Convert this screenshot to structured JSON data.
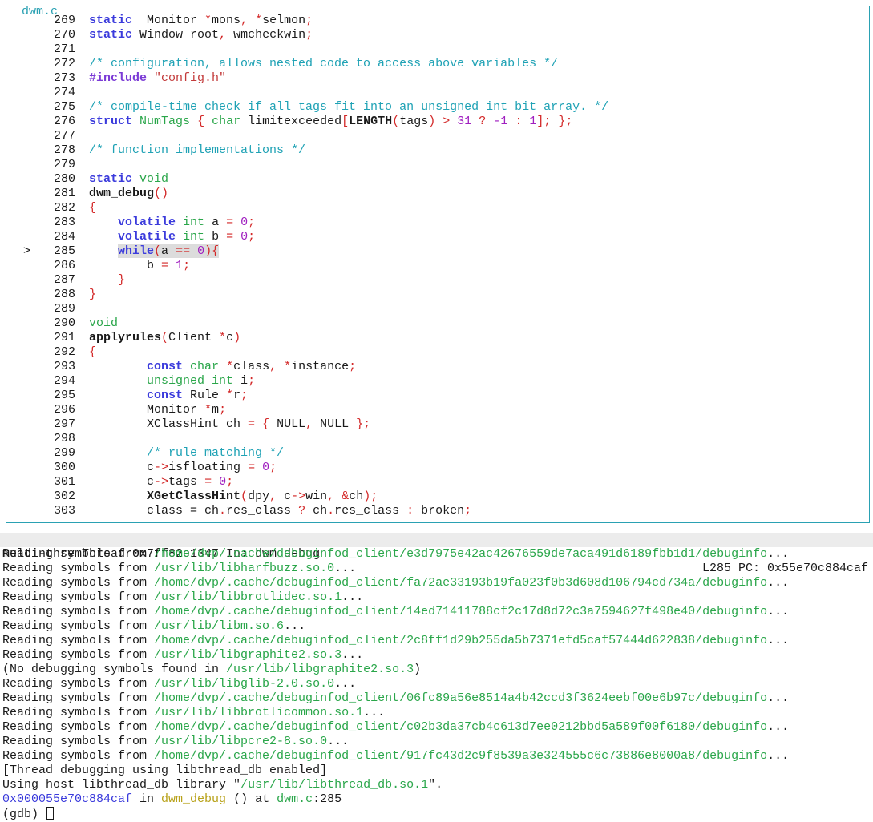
{
  "window": {
    "title": "dwm.c"
  },
  "source": {
    "current_line": 285,
    "marker": ">",
    "lines": [
      {
        "n": "269",
        "tokens": [
          [
            "kw",
            "static"
          ],
          [
            "",
            "  Monitor "
          ],
          [
            "op",
            "*"
          ],
          [
            "",
            "mons"
          ],
          [
            "op",
            ","
          ],
          [
            "",
            " "
          ],
          [
            "op",
            "*"
          ],
          [
            "",
            "selmon"
          ],
          [
            "op",
            ";"
          ]
        ]
      },
      {
        "n": "270",
        "tokens": [
          [
            "kw",
            "static"
          ],
          [
            "",
            " Window root"
          ],
          [
            "op",
            ","
          ],
          [
            "",
            " wmcheckwin"
          ],
          [
            "op",
            ";"
          ]
        ]
      },
      {
        "n": "271",
        "tokens": []
      },
      {
        "n": "272",
        "tokens": [
          [
            "cm",
            "/* configuration, allows nested code to access above variables */"
          ]
        ]
      },
      {
        "n": "273",
        "tokens": [
          [
            "pp",
            "#include"
          ],
          [
            "",
            " "
          ],
          [
            "st",
            "\"config.h\""
          ]
        ]
      },
      {
        "n": "274",
        "tokens": []
      },
      {
        "n": "275",
        "tokens": [
          [
            "cm",
            "/* compile-time check if all tags fit into an unsigned int bit array. */"
          ]
        ]
      },
      {
        "n": "276",
        "tokens": [
          [
            "kw",
            "struct"
          ],
          [
            "",
            " "
          ],
          [
            "ty",
            "NumTags"
          ],
          [
            "",
            " "
          ],
          [
            "op",
            "{"
          ],
          [
            "",
            " "
          ],
          [
            "ty",
            "char"
          ],
          [
            "",
            " limitexceeded"
          ],
          [
            "op",
            "["
          ],
          [
            "fn",
            "LENGTH"
          ],
          [
            "op",
            "("
          ],
          [
            "",
            "tags"
          ],
          [
            "op",
            ")"
          ],
          [
            "",
            " "
          ],
          [
            "op",
            ">"
          ],
          [
            "",
            " "
          ],
          [
            "nu",
            "31"
          ],
          [
            "",
            " "
          ],
          [
            "op",
            "?"
          ],
          [
            "",
            " "
          ],
          [
            "nu",
            "-1"
          ],
          [
            "",
            " "
          ],
          [
            "op",
            ":"
          ],
          [
            "",
            " "
          ],
          [
            "nu",
            "1"
          ],
          [
            "op",
            "];"
          ],
          [
            "",
            " "
          ],
          [
            "op",
            "};"
          ]
        ]
      },
      {
        "n": "277",
        "tokens": []
      },
      {
        "n": "278",
        "tokens": [
          [
            "cm",
            "/* function implementations */"
          ]
        ]
      },
      {
        "n": "279",
        "tokens": []
      },
      {
        "n": "280",
        "tokens": [
          [
            "kw",
            "static"
          ],
          [
            "",
            " "
          ],
          [
            "ty",
            "void"
          ]
        ]
      },
      {
        "n": "281",
        "tokens": [
          [
            "fn",
            "dwm_debug"
          ],
          [
            "op",
            "()"
          ]
        ]
      },
      {
        "n": "282",
        "tokens": [
          [
            "op",
            "{"
          ]
        ]
      },
      {
        "n": "283",
        "tokens": [
          [
            "",
            " "
          ],
          [
            "kw",
            "volatile"
          ],
          [
            "",
            " "
          ],
          [
            "ty",
            "int"
          ],
          [
            "",
            " a "
          ],
          [
            "op",
            "="
          ],
          [
            "",
            " "
          ],
          [
            "nu",
            "0"
          ],
          [
            "op",
            ";"
          ]
        ]
      },
      {
        "n": "284",
        "tokens": [
          [
            "",
            " "
          ],
          [
            "kw",
            "volatile"
          ],
          [
            "",
            " "
          ],
          [
            "ty",
            "int"
          ],
          [
            "",
            " b "
          ],
          [
            "op",
            "="
          ],
          [
            "",
            " "
          ],
          [
            "nu",
            "0"
          ],
          [
            "op",
            ";"
          ]
        ]
      },
      {
        "n": "285",
        "tokens": [
          [
            "",
            " "
          ],
          [
            "kw",
            "while"
          ],
          [
            "op",
            "("
          ],
          [
            "",
            "a "
          ],
          [
            "op",
            "=="
          ],
          [
            "",
            " "
          ],
          [
            "nu",
            "0"
          ],
          [
            "op",
            "){"
          ]
        ],
        "highlight": true
      },
      {
        "n": "286",
        "tokens": [
          [
            "",
            " b "
          ],
          [
            "op",
            "="
          ],
          [
            "",
            " "
          ],
          [
            "nu",
            "1"
          ],
          [
            "op",
            ";"
          ]
        ]
      },
      {
        "n": "287",
        "tokens": [
          [
            "",
            " "
          ],
          [
            "op",
            "}"
          ]
        ]
      },
      {
        "n": "288",
        "tokens": [
          [
            "op",
            "}"
          ]
        ]
      },
      {
        "n": "289",
        "tokens": []
      },
      {
        "n": "290",
        "tokens": [
          [
            "ty",
            "void"
          ]
        ]
      },
      {
        "n": "291",
        "tokens": [
          [
            "fn",
            "applyrules"
          ],
          [
            "op",
            "("
          ],
          [
            "",
            "Client "
          ],
          [
            "op",
            "*"
          ],
          [
            "",
            "c"
          ],
          [
            "op",
            ")"
          ]
        ]
      },
      {
        "n": "292",
        "tokens": [
          [
            "op",
            "{"
          ]
        ]
      },
      {
        "n": "293",
        "tokens": [
          [
            "",
            " "
          ],
          [
            "kw",
            "const"
          ],
          [
            "",
            " "
          ],
          [
            "ty",
            "char"
          ],
          [
            "",
            " "
          ],
          [
            "op",
            "*"
          ],
          [
            "",
            "class"
          ],
          [
            "op",
            ","
          ],
          [
            "",
            " "
          ],
          [
            "op",
            "*"
          ],
          [
            "",
            "instance"
          ],
          [
            "op",
            ";"
          ]
        ]
      },
      {
        "n": "294",
        "tokens": [
          [
            "",
            " "
          ],
          [
            "ty",
            "unsigned int"
          ],
          [
            "",
            " i"
          ],
          [
            "op",
            ";"
          ]
        ]
      },
      {
        "n": "295",
        "tokens": [
          [
            "",
            " "
          ],
          [
            "kw",
            "const"
          ],
          [
            "",
            " Rule "
          ],
          [
            "op",
            "*"
          ],
          [
            "",
            "r"
          ],
          [
            "op",
            ";"
          ]
        ]
      },
      {
        "n": "296",
        "tokens": [
          [
            "",
            " Monitor "
          ],
          [
            "op",
            "*"
          ],
          [
            "",
            "m"
          ],
          [
            "op",
            ";"
          ]
        ]
      },
      {
        "n": "297",
        "tokens": [
          [
            "",
            " XClassHint ch "
          ],
          [
            "op",
            "="
          ],
          [
            "",
            " "
          ],
          [
            "op",
            "{"
          ],
          [
            "",
            " NULL"
          ],
          [
            "op",
            ","
          ],
          [
            "",
            " NULL "
          ],
          [
            "op",
            "};"
          ]
        ]
      },
      {
        "n": "298",
        "tokens": []
      },
      {
        "n": "299",
        "tokens": [
          [
            "",
            " "
          ],
          [
            "cm",
            "/* rule matching */"
          ]
        ]
      },
      {
        "n": "300",
        "tokens": [
          [
            "",
            " c"
          ],
          [
            "op",
            "->"
          ],
          [
            "",
            "isfloating "
          ],
          [
            "op",
            "="
          ],
          [
            "",
            " "
          ],
          [
            "nu",
            "0"
          ],
          [
            "op",
            ";"
          ]
        ]
      },
      {
        "n": "301",
        "tokens": [
          [
            "",
            " c"
          ],
          [
            "op",
            "->"
          ],
          [
            "",
            "tags "
          ],
          [
            "op",
            "="
          ],
          [
            "",
            " "
          ],
          [
            "nu",
            "0"
          ],
          [
            "op",
            ";"
          ]
        ]
      },
      {
        "n": "302",
        "tokens": [
          [
            "",
            " "
          ],
          [
            "fn",
            "XGetClassHint"
          ],
          [
            "op",
            "("
          ],
          [
            "",
            "dpy"
          ],
          [
            "op",
            ","
          ],
          [
            "",
            " c"
          ],
          [
            "op",
            "->"
          ],
          [
            "",
            "win"
          ],
          [
            "op",
            ","
          ],
          [
            "",
            " "
          ],
          [
            "op",
            "&"
          ],
          [
            "",
            "ch"
          ],
          [
            "op",
            ");"
          ]
        ]
      },
      {
        "n": "303",
        "tokens": [
          [
            "",
            " class = ch"
          ],
          [
            "op",
            "."
          ],
          [
            "",
            "res_class "
          ],
          [
            "op",
            "?"
          ],
          [
            "",
            " ch"
          ],
          [
            "op",
            "."
          ],
          [
            "",
            "res_class "
          ],
          [
            "op",
            ":"
          ],
          [
            "",
            " broken"
          ],
          [
            "op",
            ";"
          ]
        ]
      }
    ]
  },
  "status_bar": {
    "left": "multi-thre Thread 0x7ff82c1347 In: dwm_debug",
    "right": "L285 PC: 0x55e70c884caf"
  },
  "command": {
    "lines": [
      {
        "parts": [
          [
            "",
            "Reading symbols from "
          ],
          [
            "path",
            "/home/dvp/.cache/debuginfod_client/e3d7975e42ac42676559de7aca491d6189fbb1d1/debuginfo"
          ],
          [
            "",
            "..."
          ]
        ]
      },
      {
        "parts": [
          [
            "",
            "Reading symbols from "
          ],
          [
            "path",
            "/usr/lib/libharfbuzz.so.0"
          ],
          [
            "",
            "..."
          ]
        ]
      },
      {
        "parts": [
          [
            "",
            "Reading symbols from "
          ],
          [
            "path",
            "/home/dvp/.cache/debuginfod_client/fa72ae33193b19fa023f0b3d608d106794cd734a/debuginfo"
          ],
          [
            "",
            "..."
          ]
        ]
      },
      {
        "parts": [
          [
            "",
            "Reading symbols from "
          ],
          [
            "path",
            "/usr/lib/libbrotlidec.so.1"
          ],
          [
            "",
            "..."
          ]
        ]
      },
      {
        "parts": [
          [
            "",
            "Reading symbols from "
          ],
          [
            "path",
            "/home/dvp/.cache/debuginfod_client/14ed71411788cf2c17d8d72c3a7594627f498e40/debuginfo"
          ],
          [
            "",
            "..."
          ]
        ]
      },
      {
        "parts": [
          [
            "",
            "Reading symbols from "
          ],
          [
            "path",
            "/usr/lib/libm.so.6"
          ],
          [
            "",
            "..."
          ]
        ]
      },
      {
        "parts": [
          [
            "",
            "Reading symbols from "
          ],
          [
            "path",
            "/home/dvp/.cache/debuginfod_client/2c8ff1d29b255da5b7371efd5caf57444d622838/debuginfo"
          ],
          [
            "",
            "..."
          ]
        ]
      },
      {
        "parts": [
          [
            "",
            "Reading symbols from "
          ],
          [
            "path",
            "/usr/lib/libgraphite2.so.3"
          ],
          [
            "",
            "..."
          ]
        ]
      },
      {
        "parts": [
          [
            "",
            "(No debugging symbols found in "
          ],
          [
            "path",
            "/usr/lib/libgraphite2.so.3"
          ],
          [
            "",
            ")"
          ]
        ]
      },
      {
        "parts": [
          [
            "",
            "Reading symbols from "
          ],
          [
            "path",
            "/usr/lib/libglib-2.0.so.0"
          ],
          [
            "",
            "..."
          ]
        ]
      },
      {
        "parts": [
          [
            "",
            "Reading symbols from "
          ],
          [
            "path",
            "/home/dvp/.cache/debuginfod_client/06fc89a56e8514a4b42ccd3f3624eebf00e6b97c/debuginfo"
          ],
          [
            "",
            "..."
          ]
        ]
      },
      {
        "parts": [
          [
            "",
            "Reading symbols from "
          ],
          [
            "path",
            "/usr/lib/libbrotlicommon.so.1"
          ],
          [
            "",
            "..."
          ]
        ]
      },
      {
        "parts": [
          [
            "",
            "Reading symbols from "
          ],
          [
            "path",
            "/home/dvp/.cache/debuginfod_client/c02b3da37cb4c613d7ee0212bbd5a589f00f6180/debuginfo"
          ],
          [
            "",
            "..."
          ]
        ]
      },
      {
        "parts": [
          [
            "",
            "Reading symbols from "
          ],
          [
            "path",
            "/usr/lib/libpcre2-8.so.0"
          ],
          [
            "",
            "..."
          ]
        ]
      },
      {
        "parts": [
          [
            "",
            "Reading symbols from "
          ],
          [
            "path",
            "/home/dvp/.cache/debuginfod_client/917fc43d2c9f8539a3e324555c6c73886e8000a8/debuginfo"
          ],
          [
            "",
            "..."
          ]
        ]
      },
      {
        "parts": [
          [
            "",
            "[Thread debugging using libthread_db enabled]"
          ]
        ]
      },
      {
        "parts": [
          [
            "",
            "Using host libthread_db library \""
          ],
          [
            "path",
            "/usr/lib/libthread_db.so.1"
          ],
          [
            "",
            "\"."
          ]
        ]
      },
      {
        "parts": [
          [
            "addr",
            "0x000055e70c884caf"
          ],
          [
            "",
            " in "
          ],
          [
            "func",
            "dwm_debug"
          ],
          [
            "",
            " () at "
          ],
          [
            "file",
            "dwm.c"
          ],
          [
            "",
            ":285"
          ]
        ]
      }
    ],
    "prompt": "(gdb) "
  },
  "colors": {
    "border": "#2aa1b3",
    "keyword": "#3b3bdc",
    "type": "#2aa64a",
    "comment": "#1fa2b5",
    "operator": "#d32828",
    "number": "#a020c0",
    "path": "#2aa64a",
    "function_name": "#b8a21a"
  }
}
